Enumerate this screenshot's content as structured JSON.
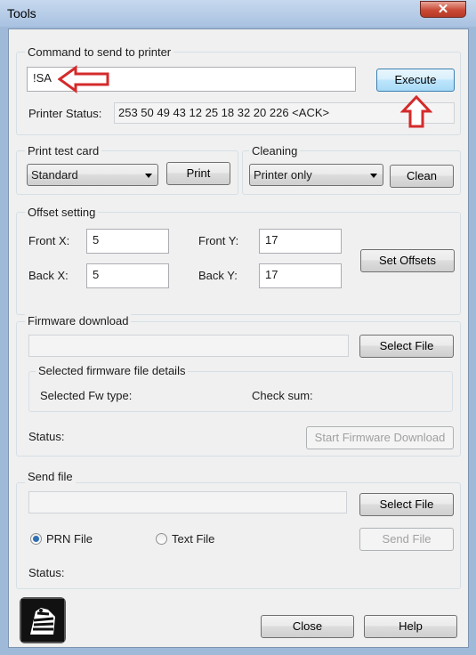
{
  "window": {
    "title": "Tools",
    "close_glyph": "✕"
  },
  "command": {
    "group_label": "Command to send to printer",
    "value": "!SA",
    "execute_label": "Execute",
    "status_label": "Printer Status:",
    "status_value": "253 50 49 43 12 25 18 32 20 226 <ACK>"
  },
  "print_test": {
    "group_label": "Print test card",
    "selected": "Standard",
    "print_label": "Print"
  },
  "cleaning": {
    "group_label": "Cleaning",
    "selected": "Printer only",
    "clean_label": "Clean"
  },
  "offset": {
    "group_label": "Offset setting",
    "front_x_label": "Front X:",
    "front_x": "5",
    "front_y_label": "Front Y:",
    "front_y": "17",
    "back_x_label": "Back X:",
    "back_x": "5",
    "back_y_label": "Back Y:",
    "back_y": "17",
    "set_label": "Set Offsets"
  },
  "firmware": {
    "group_label": "Firmware download",
    "path": "",
    "select_label": "Select File",
    "details_label": "Selected firmware file details",
    "fw_type_label": "Selected Fw type:",
    "checksum_label": "Check sum:",
    "status_label": "Status:",
    "start_label": "Start Firmware Download"
  },
  "send_file": {
    "group_label": "Send file",
    "path": "",
    "select_label": "Select File",
    "prn_label": "PRN File",
    "text_label": "Text File",
    "send_label": "Send File",
    "status_label": "Status:",
    "selected_type": "PRN File"
  },
  "footer": {
    "close_label": "Close",
    "help_label": "Help"
  },
  "annotations": {
    "color": "#d42a2a",
    "icons": [
      "arrow-left-icon",
      "arrow-up-icon"
    ]
  }
}
